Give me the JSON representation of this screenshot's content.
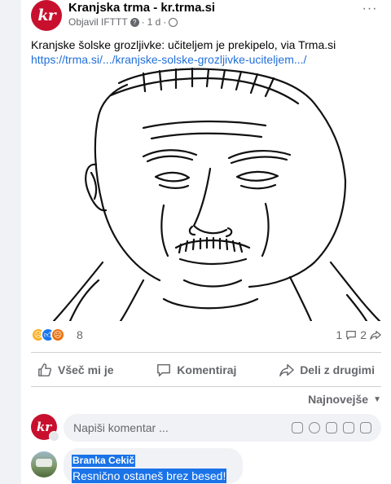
{
  "post": {
    "author": "Kranjska trma - kr.trma.si",
    "avatar_text": "kr",
    "meta_published_by": "Objavil IFTTT",
    "meta_time": "1 d",
    "more_label": "···",
    "text": "Kranjske šolske grozljivke: učiteljem je prekipelo, via Trma.si",
    "link": "https://trma.si/.../kranjske-solske-grozljivke-uciteljem.../",
    "image_icon": "line-drawing-portrait"
  },
  "reactions": {
    "icons": [
      "sad-reaction-icon",
      "like-reaction-icon",
      "angry-reaction-icon"
    ],
    "count": "8",
    "comments_count": "1",
    "shares_count": "2"
  },
  "actions": {
    "like": "Všeč mi je",
    "comment": "Komentiraj",
    "share": "Deli z drugimi"
  },
  "sort": {
    "label": "Najnovejše"
  },
  "composer": {
    "avatar_text": "kr",
    "placeholder": "Napiši komentar ..."
  },
  "comment": {
    "name": "Branka Cekič",
    "text": "Resnično ostaneš brez besed!"
  },
  "colors": {
    "brand_red": "#c8102e",
    "link_blue": "#216fdb",
    "selection_blue": "#1a73e8",
    "muted": "#65676b"
  }
}
